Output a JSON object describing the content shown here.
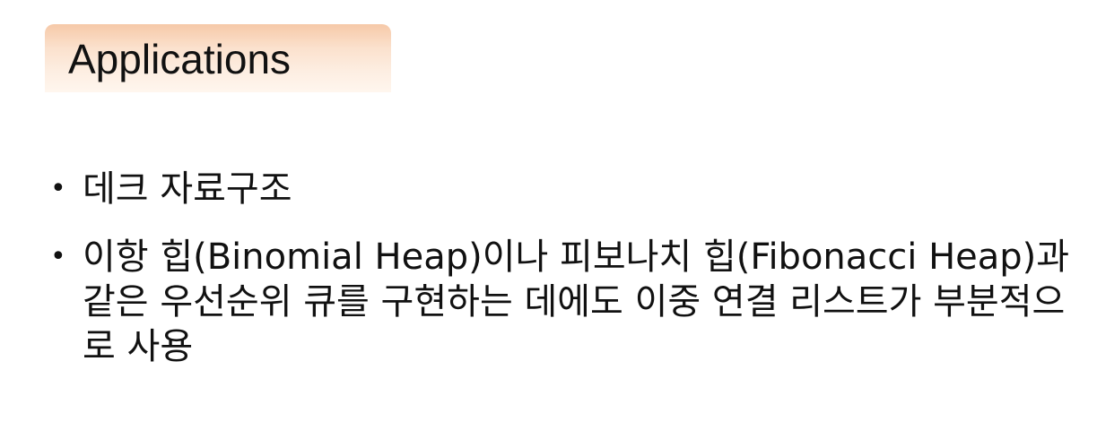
{
  "slide": {
    "title": "Applications",
    "bullets": [
      {
        "marker": "•",
        "text": "데크 자료구조"
      },
      {
        "marker": "•",
        "text": "이항 힙(Binomial Heap)이나 피보나치 힙(Fibonacci Heap)과 같은 우선순위 큐를 구현하는 데에도 이중 연결 리스트가 부분적으로 사용"
      }
    ]
  },
  "colors": {
    "banner_top": "#f6c9a8",
    "banner_bottom": "#fff6ee",
    "text": "#111111",
    "background": "#ffffff"
  }
}
